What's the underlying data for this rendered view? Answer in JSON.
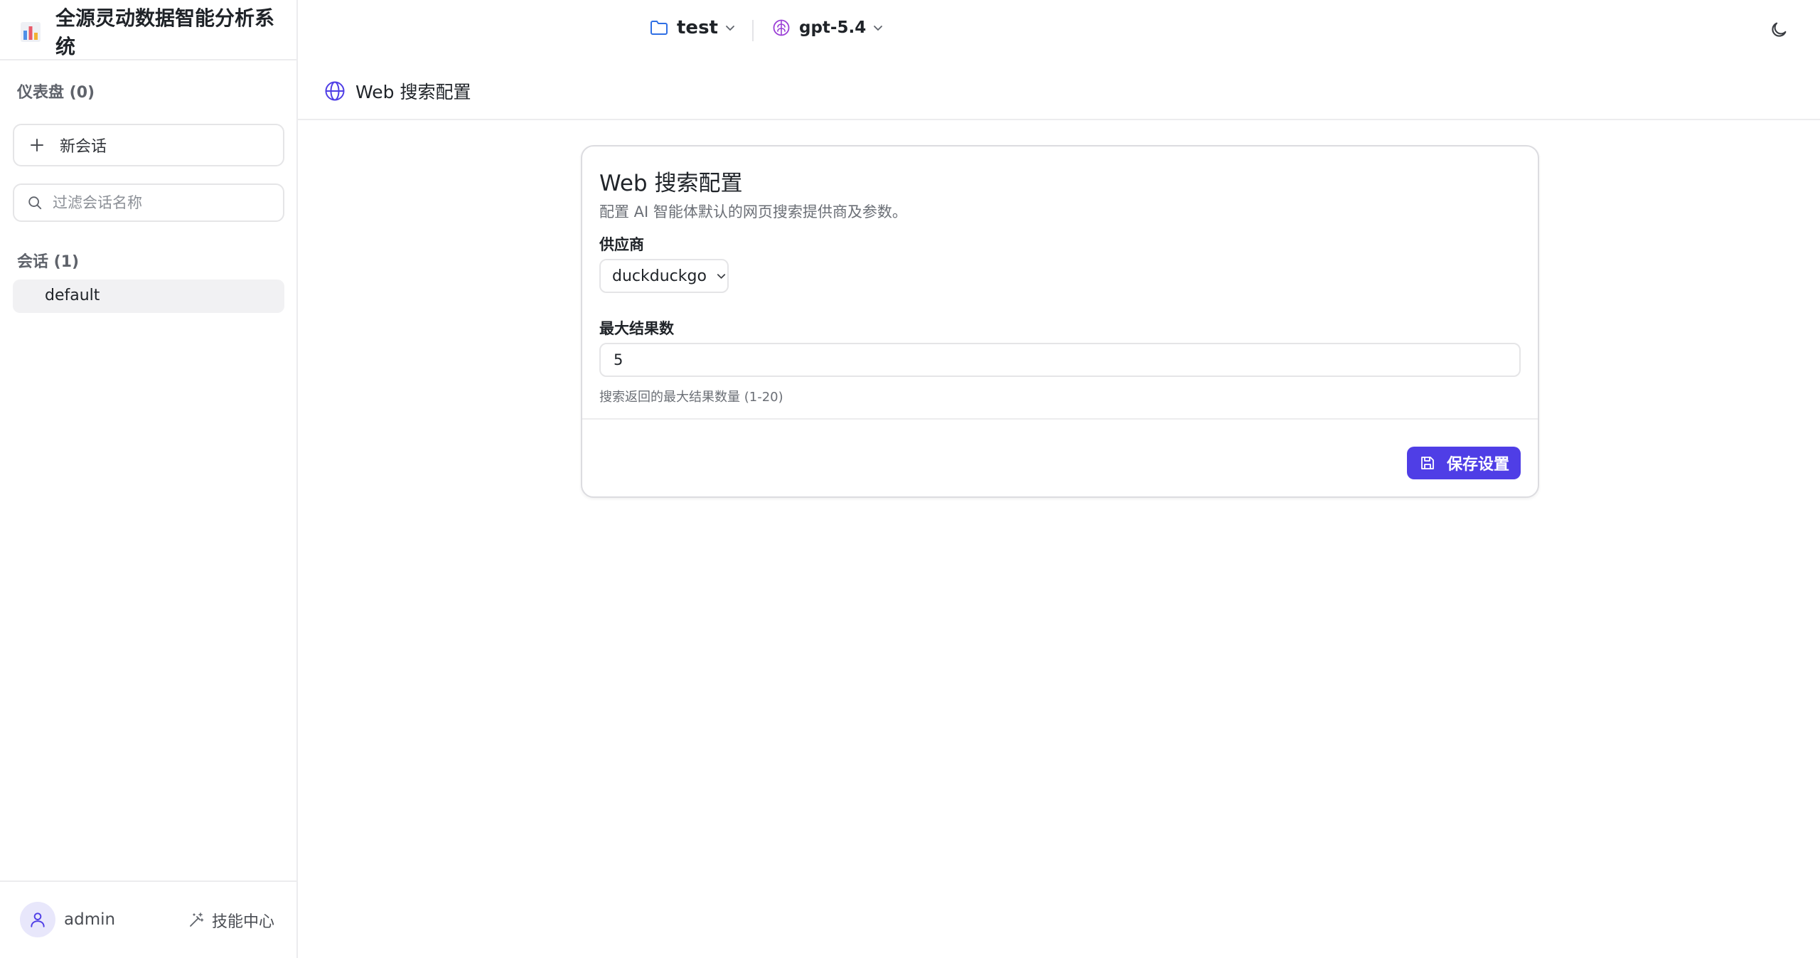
{
  "app": {
    "title": "全源灵动数据智能分析系统"
  },
  "sidebar": {
    "dashboard_title": "仪表盘 (0)",
    "new_chat_label": "新会话",
    "filter_placeholder": "过滤会话名称",
    "sessions_title": "会话 (1)",
    "sessions": [
      {
        "label": "default",
        "active": true
      }
    ],
    "user": "admin",
    "skills_label": "技能中心"
  },
  "topbar": {
    "project": "test",
    "model": "gpt-5.4",
    "theme_icon": "moon-icon"
  },
  "page": {
    "header": "Web 搜索配置"
  },
  "card": {
    "title": "Web 搜索配置",
    "description": "配置 AI 智能体默认的网页搜索提供商及参数。",
    "provider_label": "供应商",
    "provider_value": "duckduckgo",
    "max_results_label": "最大结果数",
    "max_results_value": "5",
    "max_results_hint": "搜索返回的最大结果数量 (1-20)",
    "save_label": "保存设置"
  },
  "colors": {
    "accent": "#4f3ee6",
    "brain_icon": "#9b3fd6",
    "folder_icon": "#2f6fe4"
  }
}
